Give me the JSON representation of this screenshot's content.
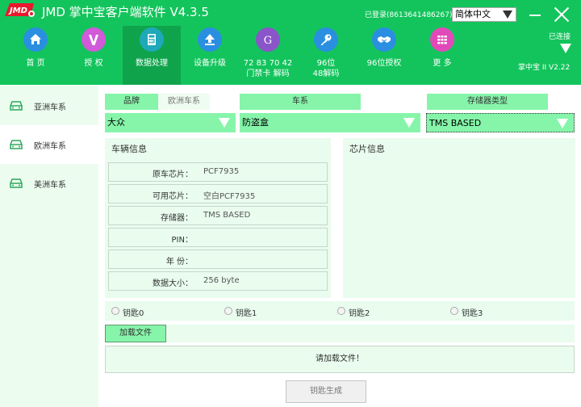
{
  "app": {
    "logo_text": "JMD",
    "title": "JMD 掌中宝客户端软件 V4.3.5",
    "login_status": "已登录(8613641486267)",
    "language": "简体中文",
    "connection_status": "已连接",
    "device_version": "掌中宝 II V2.22"
  },
  "nav": {
    "items": [
      {
        "label": "首 页",
        "icon": "home-icon",
        "color": "#2a8fe0"
      },
      {
        "label": "授 权",
        "icon": "letter-v-icon",
        "color": "#d05ad8"
      },
      {
        "label": "数据处理",
        "icon": "calculator-icon",
        "color": "#1fa8b8",
        "active": true
      },
      {
        "label": "设备升级",
        "icon": "upload-arrow-icon",
        "color": "#2a8fe0"
      },
      {
        "label": "72 83 70 42\n门禁卡 解码",
        "icon": "letter-g-icon",
        "color": "#8a55c8"
      },
      {
        "label": "96位\n48解码",
        "icon": "key-icon",
        "color": "#2a8fe0"
      },
      {
        "label": "96位授权",
        "icon": "handshake-icon",
        "color": "#2a8fe0"
      },
      {
        "label": "更 多",
        "icon": "grid-icon",
        "color": "#e04ab8"
      }
    ]
  },
  "sidebar": {
    "items": [
      {
        "label": "亚洲车系"
      },
      {
        "label": "欧洲车系",
        "active": true
      },
      {
        "label": "美洲车系"
      }
    ]
  },
  "filters": {
    "tab_brand": "品牌",
    "tab_region": "欧洲车系",
    "col_series": "车系",
    "col_storage_type": "存储器类型",
    "brand_value": "大众",
    "series_value": "防盗盒",
    "storage_value": "TMS BASED"
  },
  "vehicle_info": {
    "title": "车辆信息",
    "rows": [
      {
        "label": "原车芯片：",
        "value": "PCF7935"
      },
      {
        "label": "可用芯片：",
        "value": "空白PCF7935"
      },
      {
        "label": "存储器：",
        "value": "TMS BASED"
      },
      {
        "label": "PIN：",
        "value": ""
      },
      {
        "label": "年 份：",
        "value": ""
      },
      {
        "label": "数据大小：",
        "value": "256 byte"
      }
    ]
  },
  "chip_info": {
    "title": "芯片信息"
  },
  "keys": {
    "options": [
      "钥匙0",
      "钥匙1",
      "钥匙2",
      "钥匙3"
    ]
  },
  "actions": {
    "load_file": "加载文件",
    "status_message": "请加载文件！",
    "generate_key": "钥匙生成"
  }
}
